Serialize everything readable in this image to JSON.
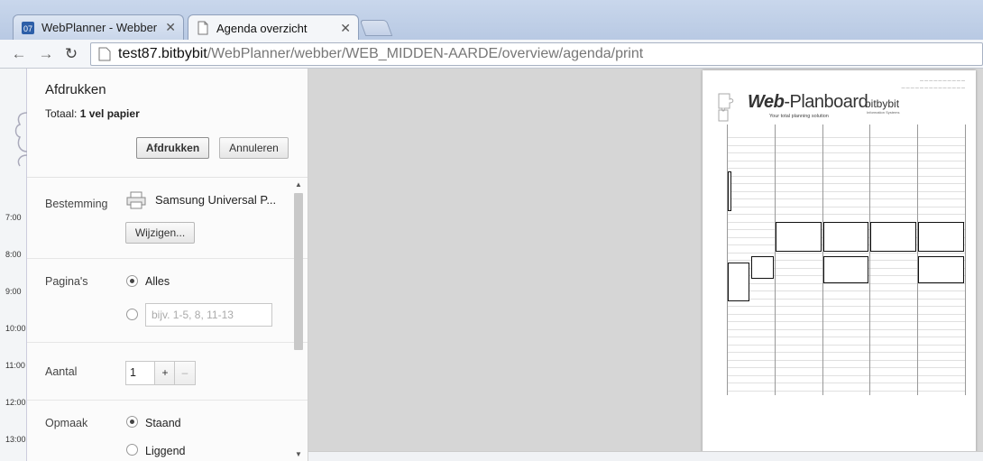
{
  "browser": {
    "tabs": [
      {
        "title": "WebPlanner - Webber",
        "active": false
      },
      {
        "title": "Agenda overzicht",
        "active": true
      }
    ],
    "url": {
      "host": "test87.bitbybit",
      "path": "/WebPlanner/webber/WEB_MIDDEN-AARDE/overview/agenda/print"
    }
  },
  "background_times": [
    "7:00",
    "8:00",
    "9:00",
    "10:00",
    "11:00",
    "12:00",
    "13:00"
  ],
  "print": {
    "title": "Afdrukken",
    "total_label": "Totaal:",
    "total_value": "1 vel papier",
    "print_button": "Afdrukken",
    "cancel_button": "Annuleren",
    "destination": {
      "label": "Bestemming",
      "printer": "Samsung Universal P...",
      "change_button": "Wijzigen..."
    },
    "pages": {
      "label": "Pagina's",
      "all_option": "Alles",
      "all_selected": true,
      "custom_placeholder": "bijv. 1-5, 8, 11-13"
    },
    "copies": {
      "label": "Aantal",
      "value": "1",
      "plus": "+",
      "minus": "–"
    },
    "layout": {
      "label": "Opmaak",
      "portrait": "Staand",
      "landscape": "Liggend",
      "portrait_selected": true
    }
  },
  "preview": {
    "brand_logo_bold": "Web",
    "brand_logo_rest": "-Planboard",
    "tagline": "Your total planning solution",
    "company": "bitbybit",
    "company_sub": "Information Systems"
  },
  "colors": {
    "tabstrip": "#c9d7ec",
    "preview_bg": "#d6d6d6",
    "panel_bg": "#fbfbfb"
  }
}
